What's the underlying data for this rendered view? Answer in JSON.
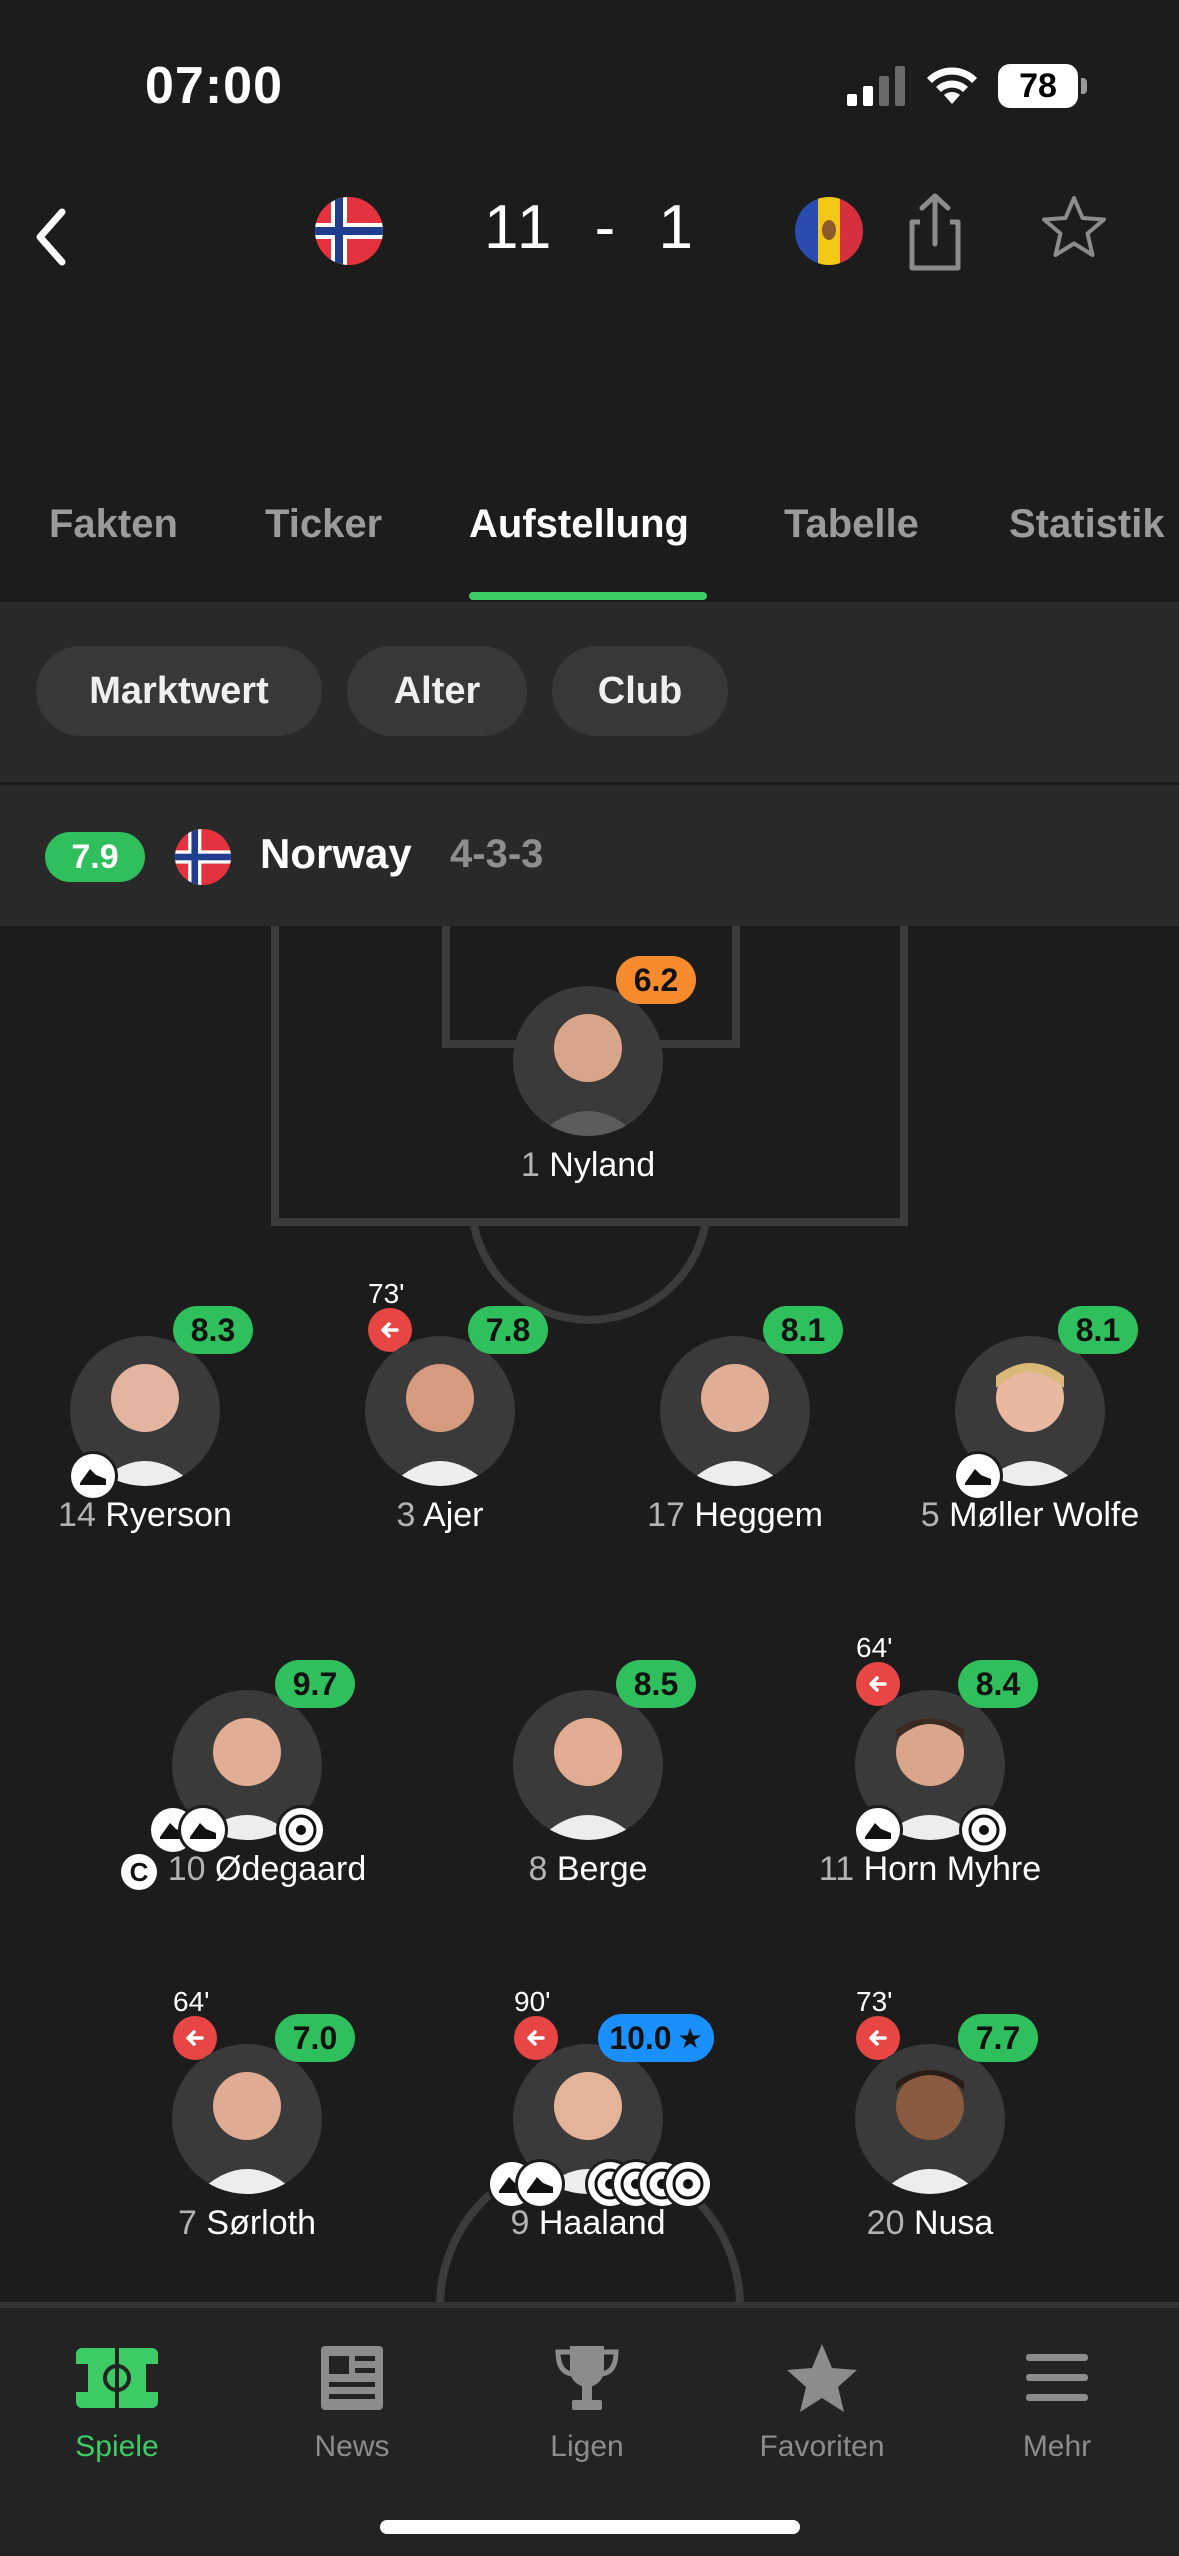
{
  "status_bar": {
    "time": "07:00",
    "battery": "78"
  },
  "match": {
    "score": "11 - 1",
    "home_team": "Norway",
    "away_team": "Moldova"
  },
  "tabs": [
    "Fakten",
    "Ticker",
    "Aufstellung",
    "Tabelle",
    "Statistik"
  ],
  "active_tab": "Aufstellung",
  "filters": [
    "Marktwert",
    "Alter",
    "Club"
  ],
  "team": {
    "rating": "7.9",
    "name": "Norway",
    "formation": "4-3-3"
  },
  "players": [
    {
      "number": "1",
      "name": "Nyland",
      "rating": "6.2"
    },
    {
      "number": "14",
      "name": "Ryerson",
      "rating": "8.3"
    },
    {
      "number": "3",
      "name": "Ajer",
      "rating": "7.8",
      "sub_time": "73'"
    },
    {
      "number": "17",
      "name": "Heggem",
      "rating": "8.1"
    },
    {
      "number": "5",
      "name": "Møller Wolfe",
      "rating": "8.1"
    },
    {
      "number": "10",
      "name": "Ødegaard",
      "rating": "9.7",
      "captain": "C"
    },
    {
      "number": "8",
      "name": "Berge",
      "rating": "8.5"
    },
    {
      "number": "11",
      "name": "Horn Myhre",
      "rating": "8.4",
      "sub_time": "64'"
    },
    {
      "number": "7",
      "name": "Sørloth",
      "rating": "7.0",
      "sub_time": "64'"
    },
    {
      "number": "9",
      "name": "Haaland",
      "rating": "10.0",
      "sub_time": "90'"
    },
    {
      "number": "20",
      "name": "Nusa",
      "rating": "7.7",
      "sub_time": "73'"
    }
  ],
  "bottom_nav": [
    "Spiele",
    "News",
    "Ligen",
    "Favoriten",
    "Mehr"
  ],
  "colors": {
    "accent": "#3ccb64",
    "rating_green": "#2fbf5d",
    "rating_orange": "#f68b2d",
    "rating_blue": "#1a90ff",
    "sub_red": "#e84545"
  }
}
